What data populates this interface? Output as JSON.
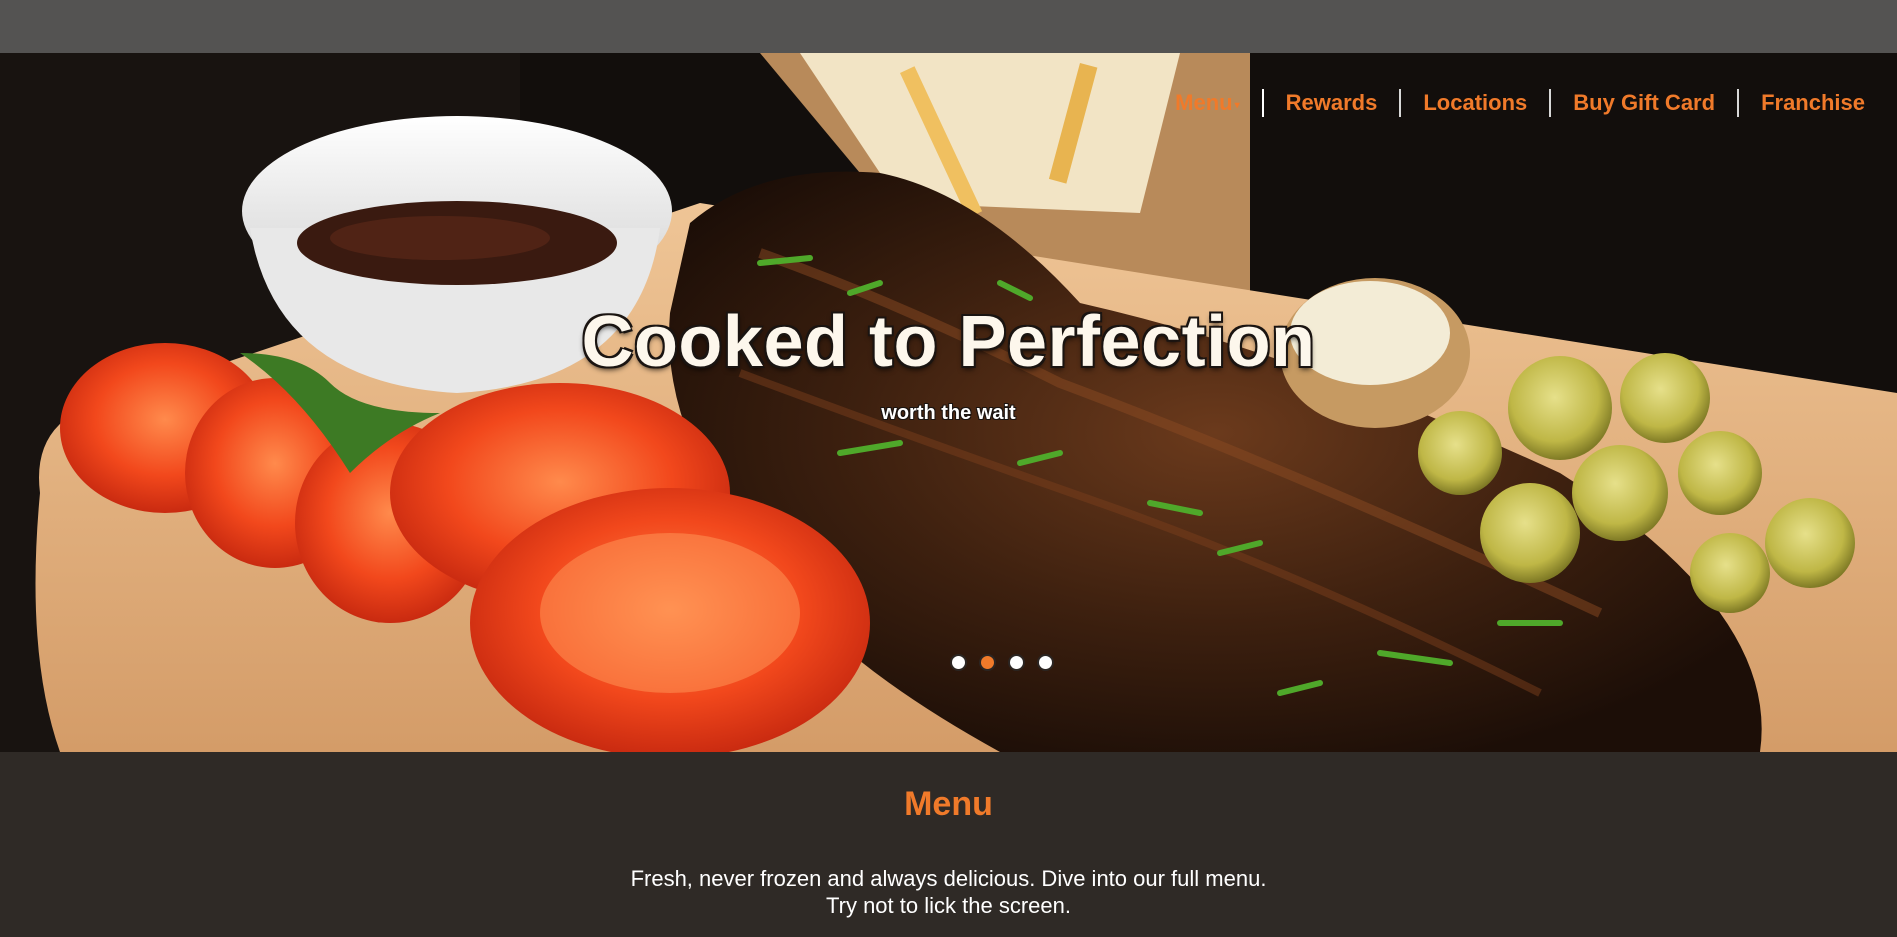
{
  "nav": {
    "items": [
      {
        "label": "Menu",
        "has_dropdown": true
      },
      {
        "label": "Rewards"
      },
      {
        "label": "Locations"
      },
      {
        "label": "Buy Gift Card"
      },
      {
        "label": "Franchise"
      }
    ]
  },
  "hero": {
    "headline": "Cooked to Perfection",
    "subline": "worth the wait",
    "carousel": {
      "slide_count": 4,
      "active_index": 1
    }
  },
  "menu_section": {
    "title": "Menu",
    "description_line1": "Fresh, never frozen and always delicious. Dive into our full menu.",
    "description_line2": "Try not to lick the screen."
  },
  "colors": {
    "accent": "#f07a2a",
    "topbar": "#545352",
    "section_bg": "#2f2a26"
  },
  "icons": {
    "dropdown": "caret-down-icon"
  }
}
